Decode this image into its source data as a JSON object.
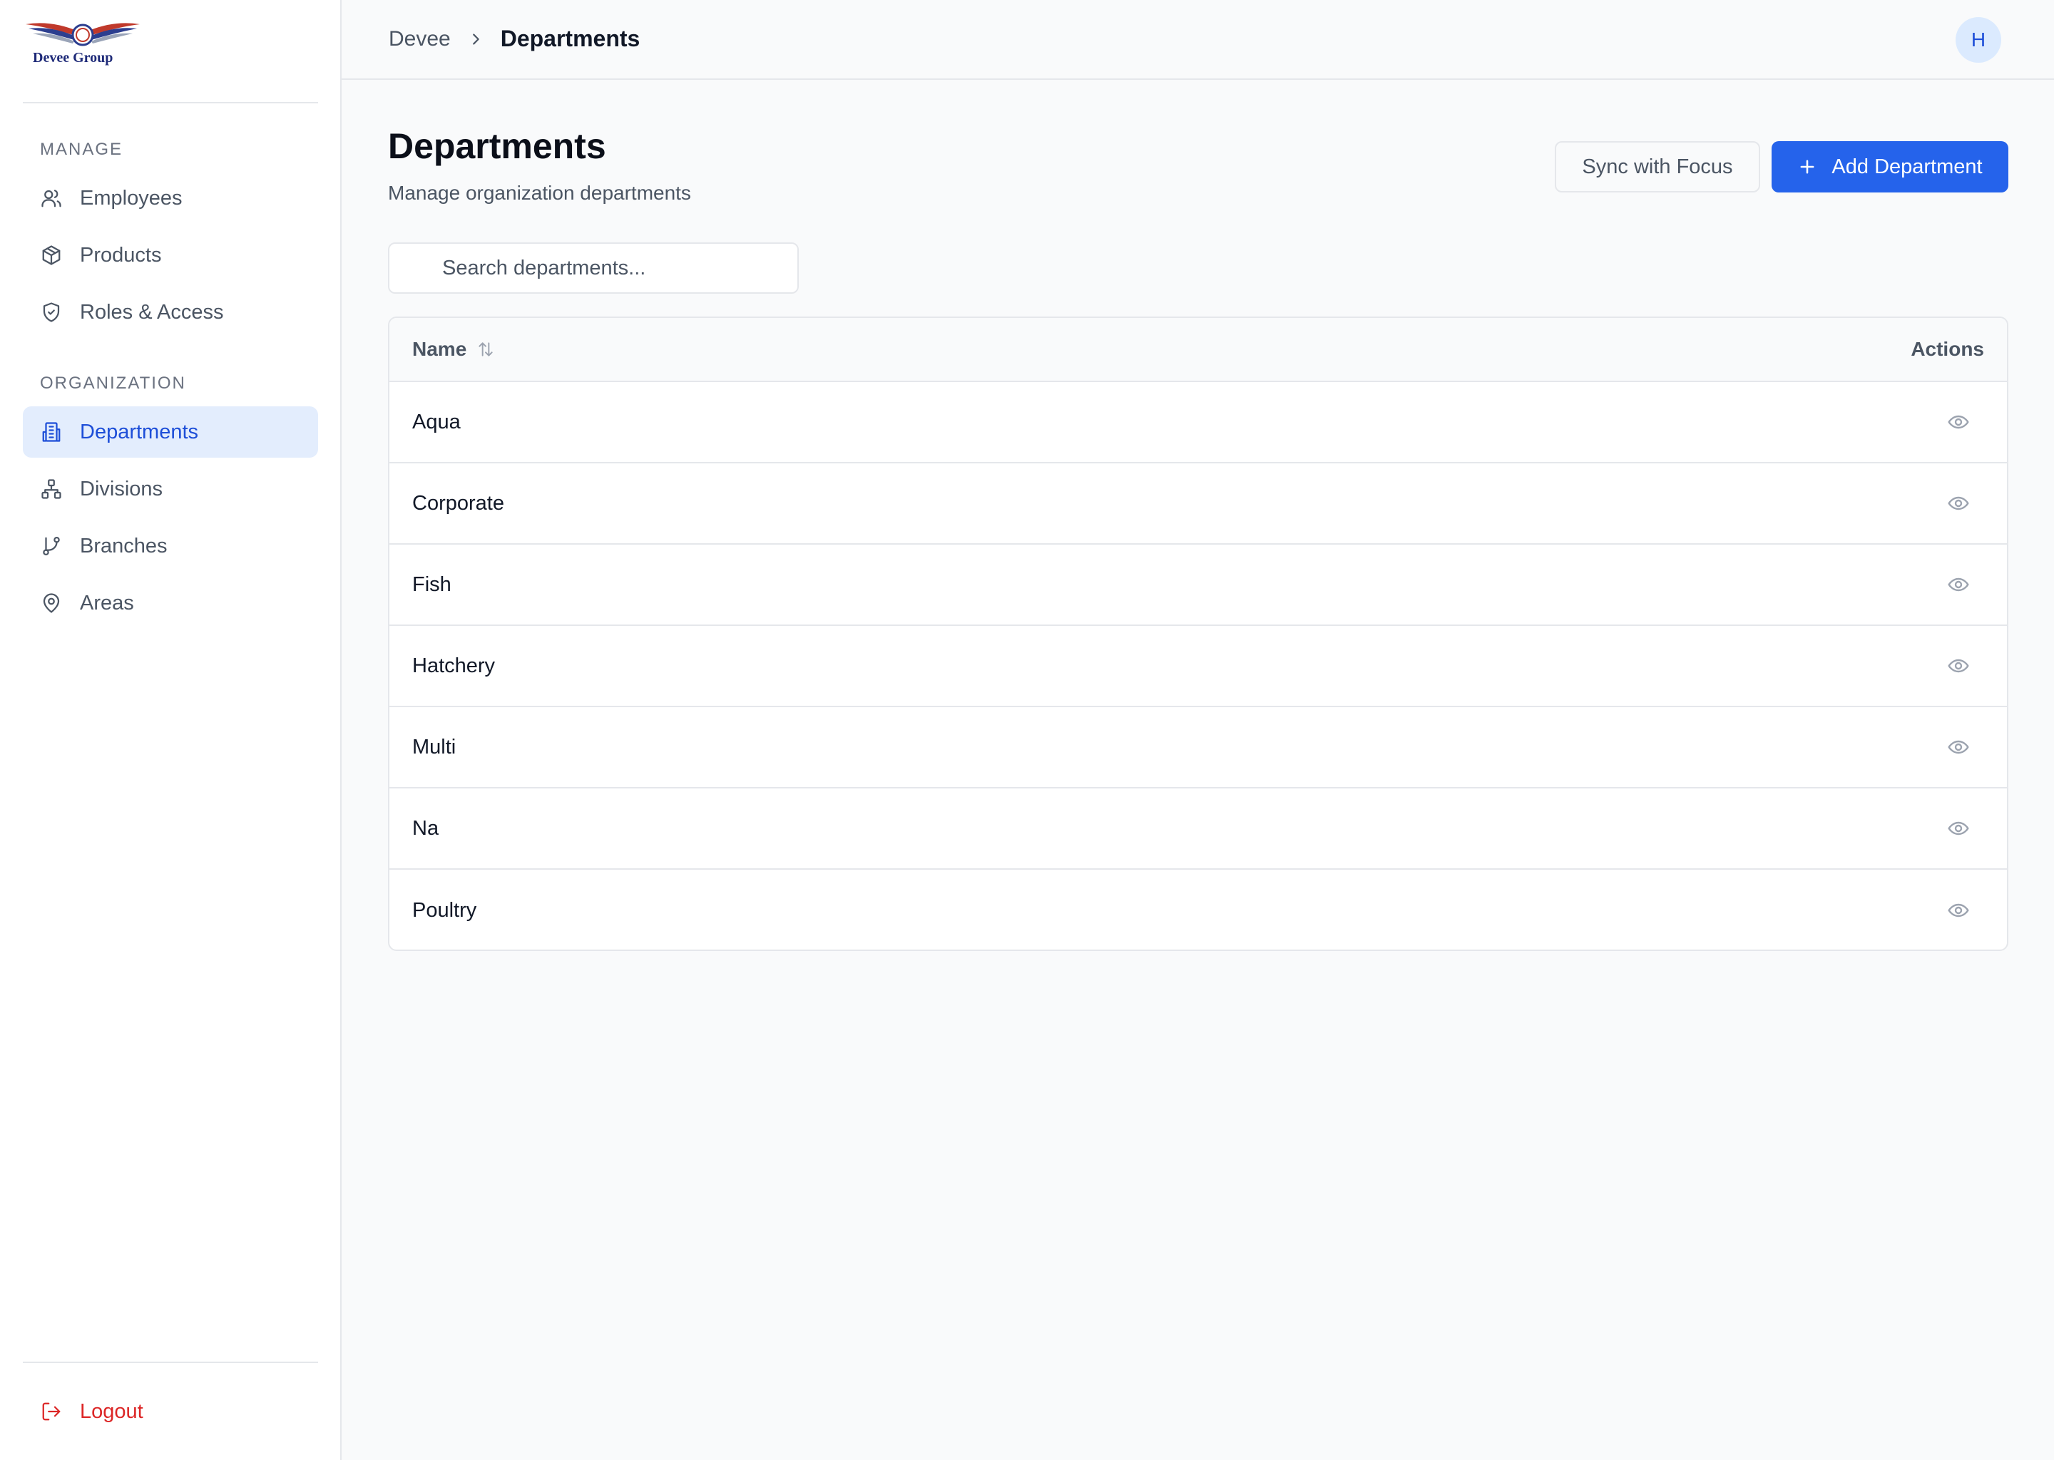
{
  "brand": {
    "name": "Devee Group"
  },
  "sidebar": {
    "sections": [
      {
        "label": "MANAGE",
        "items": [
          {
            "label": "Employees",
            "icon": "users-icon"
          },
          {
            "label": "Products",
            "icon": "package-icon"
          },
          {
            "label": "Roles & Access",
            "icon": "shield-icon"
          }
        ]
      },
      {
        "label": "ORGANIZATION",
        "items": [
          {
            "label": "Departments",
            "icon": "building-icon",
            "active": true
          },
          {
            "label": "Divisions",
            "icon": "network-icon"
          },
          {
            "label": "Branches",
            "icon": "git-branch-icon"
          },
          {
            "label": "Areas",
            "icon": "map-pin-icon"
          }
        ]
      }
    ],
    "logout": {
      "label": "Logout",
      "icon": "logout-icon"
    }
  },
  "topbar": {
    "breadcrumb": {
      "root": "Devee",
      "current": "Departments"
    },
    "avatar_initial": "H"
  },
  "main": {
    "title": "Departments",
    "subtitle": "Manage organization departments",
    "sync_button": "Sync with Focus",
    "add_button": "Add Department",
    "search_placeholder": "Search departments...",
    "table": {
      "columns": {
        "name": "Name",
        "actions": "Actions"
      },
      "rows": [
        "Aqua",
        "Corporate",
        "Fish",
        "Hatchery",
        "Multi",
        "Na",
        "Poultry"
      ]
    }
  },
  "colors": {
    "accent": "#2563eb",
    "active_bg": "#e3edfd",
    "danger": "#dc2626"
  }
}
